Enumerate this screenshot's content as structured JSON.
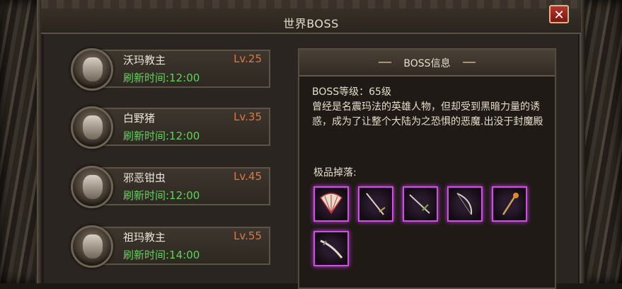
{
  "window": {
    "title": "世界BOSS",
    "close_label": "✕"
  },
  "boss_list": [
    {
      "name": "沃玛教主",
      "level": "Lv.25",
      "refresh": "刷新时间:12:00"
    },
    {
      "name": "白野猪",
      "level": "Lv.35",
      "refresh": "刷新时间:12:00"
    },
    {
      "name": "邪恶钳虫",
      "level": "Lv.45",
      "refresh": "刷新时间:12:00"
    },
    {
      "name": "祖玛教主",
      "level": "Lv.55",
      "refresh": "刷新时间:14:00"
    }
  ],
  "info_panel": {
    "title": "BOSS信息",
    "level_line": "BOSS等级：65级",
    "description": "曾经是名震玛法的英雄人物，但却受到黑暗力量的诱惑，成为了让整个大陆为之恐惧的恶魔.出没于封魔殿",
    "drops_label": "极品掉落:",
    "drops": [
      {
        "icon": "fan-icon"
      },
      {
        "icon": "sword-icon"
      },
      {
        "icon": "sword-icon"
      },
      {
        "icon": "bow-icon"
      },
      {
        "icon": "staff-icon"
      },
      {
        "icon": "blade-icon"
      }
    ]
  },
  "colors": {
    "level": "#e0773b",
    "refresh": "#5fd35a",
    "item_glow": "#d24ce6"
  }
}
